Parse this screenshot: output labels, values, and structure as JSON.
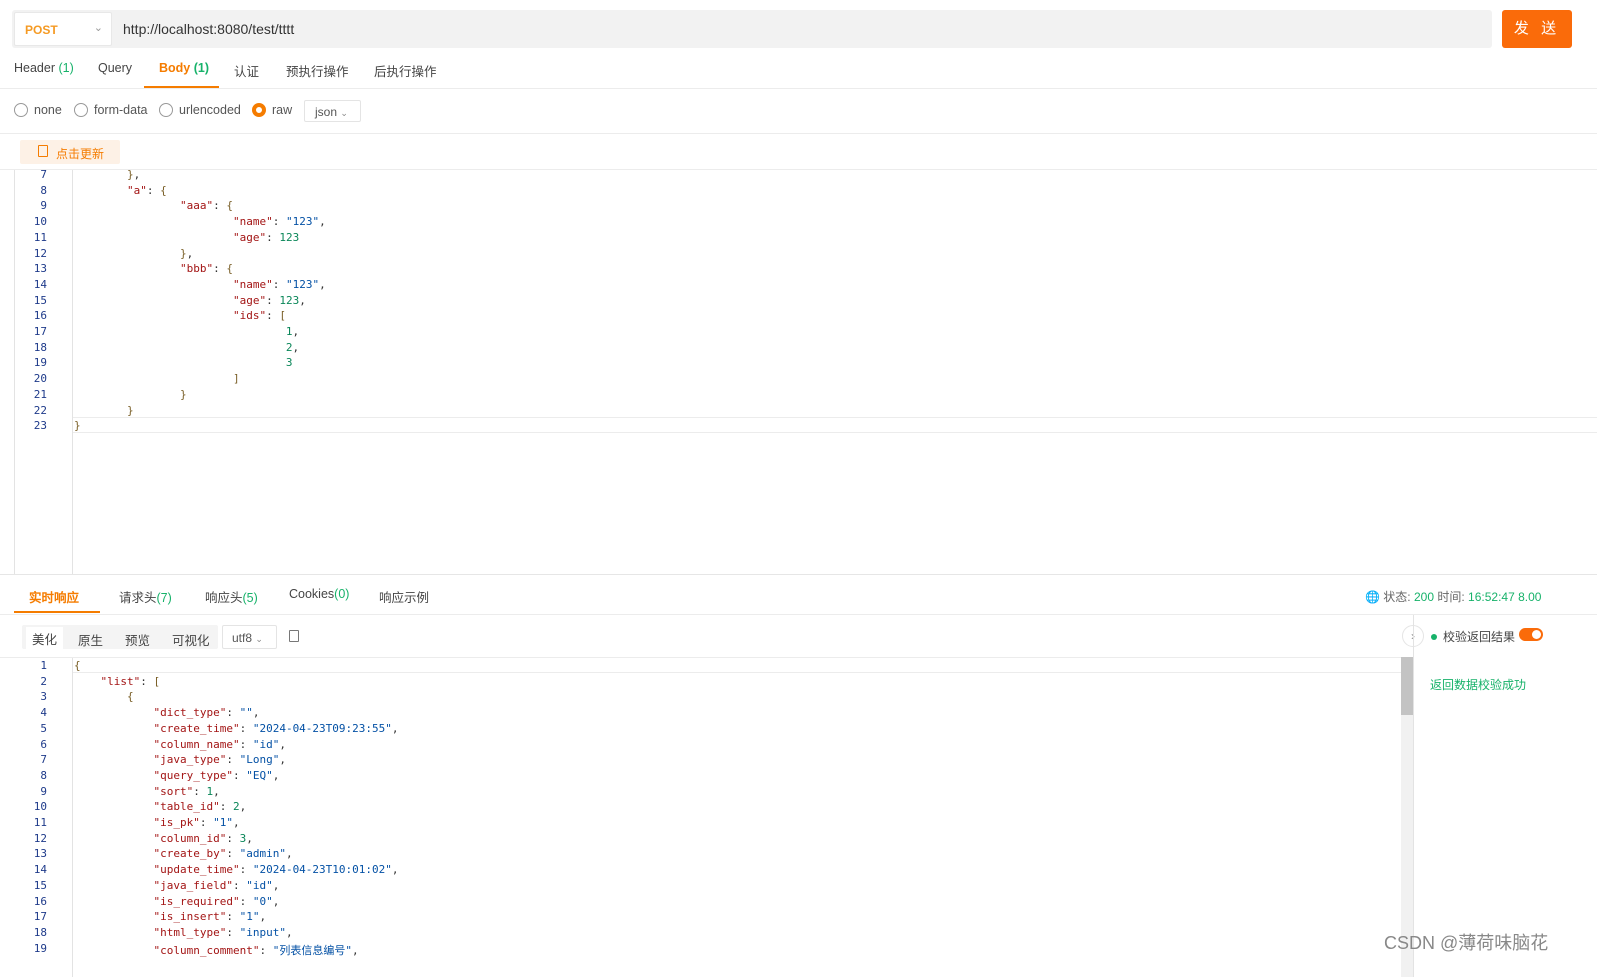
{
  "request": {
    "method": "POST",
    "url": "http://localhost:8080/test/tttt",
    "send_label": "发 送"
  },
  "request_tabs": [
    {
      "label": "Header",
      "count": "(1)"
    },
    {
      "label": "Query",
      "count": ""
    },
    {
      "label": "Body",
      "count": "(1)"
    },
    {
      "label": "认证",
      "count": ""
    },
    {
      "label": "预执行操作",
      "count": ""
    },
    {
      "label": "后执行操作",
      "count": ""
    }
  ],
  "active_request_tab": "Body",
  "body_types": [
    "none",
    "form-data",
    "urlencoded",
    "raw"
  ],
  "selected_body_type": "raw",
  "raw_format": "json",
  "update_button": "点击更新",
  "request_lines": [
    {
      "n": "7",
      "t": "        },"
    },
    {
      "n": "8",
      "t": "        \"a\": {"
    },
    {
      "n": "9",
      "t": "                \"aaa\": {"
    },
    {
      "n": "10",
      "t": "                        \"name\": \"123\","
    },
    {
      "n": "11",
      "t": "                        \"age\": 123"
    },
    {
      "n": "12",
      "t": "                },"
    },
    {
      "n": "13",
      "t": "                \"bbb\": {"
    },
    {
      "n": "14",
      "t": "                        \"name\": \"123\","
    },
    {
      "n": "15",
      "t": "                        \"age\": 123,"
    },
    {
      "n": "16",
      "t": "                        \"ids\": ["
    },
    {
      "n": "17",
      "t": "                                1,"
    },
    {
      "n": "18",
      "t": "                                2,"
    },
    {
      "n": "19",
      "t": "                                3"
    },
    {
      "n": "20",
      "t": "                        ]"
    },
    {
      "n": "21",
      "t": "                }"
    },
    {
      "n": "22",
      "t": "        }"
    },
    {
      "n": "23",
      "t": "}"
    }
  ],
  "response_tabs": [
    {
      "label": "实时响应",
      "count": ""
    },
    {
      "label": "请求头",
      "count": "(7)"
    },
    {
      "label": "响应头",
      "count": "(5)"
    },
    {
      "label": "Cookies",
      "count": "(0)"
    },
    {
      "label": "响应示例",
      "count": ""
    }
  ],
  "status": {
    "status_label": "状态:",
    "status_value": "200",
    "time_label": "时间:",
    "time_value": "16:52:47",
    "extra": "8.00"
  },
  "format_tabs": [
    "美化",
    "原生",
    "预览",
    "可视化"
  ],
  "encoding": "utf8",
  "validate_label": "校验返回结果",
  "validate_message": "返回数据校验成功",
  "response_lines": [
    {
      "n": "1",
      "t": "{"
    },
    {
      "n": "2",
      "t": "    \"list\": ["
    },
    {
      "n": "3",
      "t": "        {"
    },
    {
      "n": "4",
      "t": "            \"dict_type\": \"\","
    },
    {
      "n": "5",
      "t": "            \"create_time\": \"2024-04-23T09:23:55\","
    },
    {
      "n": "6",
      "t": "            \"column_name\": \"id\","
    },
    {
      "n": "7",
      "t": "            \"java_type\": \"Long\","
    },
    {
      "n": "8",
      "t": "            \"query_type\": \"EQ\","
    },
    {
      "n": "9",
      "t": "            \"sort\": 1,"
    },
    {
      "n": "10",
      "t": "            \"table_id\": 2,"
    },
    {
      "n": "11",
      "t": "            \"is_pk\": \"1\","
    },
    {
      "n": "12",
      "t": "            \"column_id\": 3,"
    },
    {
      "n": "13",
      "t": "            \"create_by\": \"admin\","
    },
    {
      "n": "14",
      "t": "            \"update_time\": \"2024-04-23T10:01:02\","
    },
    {
      "n": "15",
      "t": "            \"java_field\": \"id\","
    },
    {
      "n": "16",
      "t": "            \"is_required\": \"0\","
    },
    {
      "n": "17",
      "t": "            \"is_insert\": \"1\","
    },
    {
      "n": "18",
      "t": "            \"html_type\": \"input\","
    },
    {
      "n": "19",
      "t": "            \"column_comment\": \"列表信息编号\","
    }
  ],
  "watermark": "CSDN @薄荷味脑花",
  "colors": {
    "accent": "#f57c00",
    "send": "#fa6b0a",
    "success": "#17b26a"
  }
}
